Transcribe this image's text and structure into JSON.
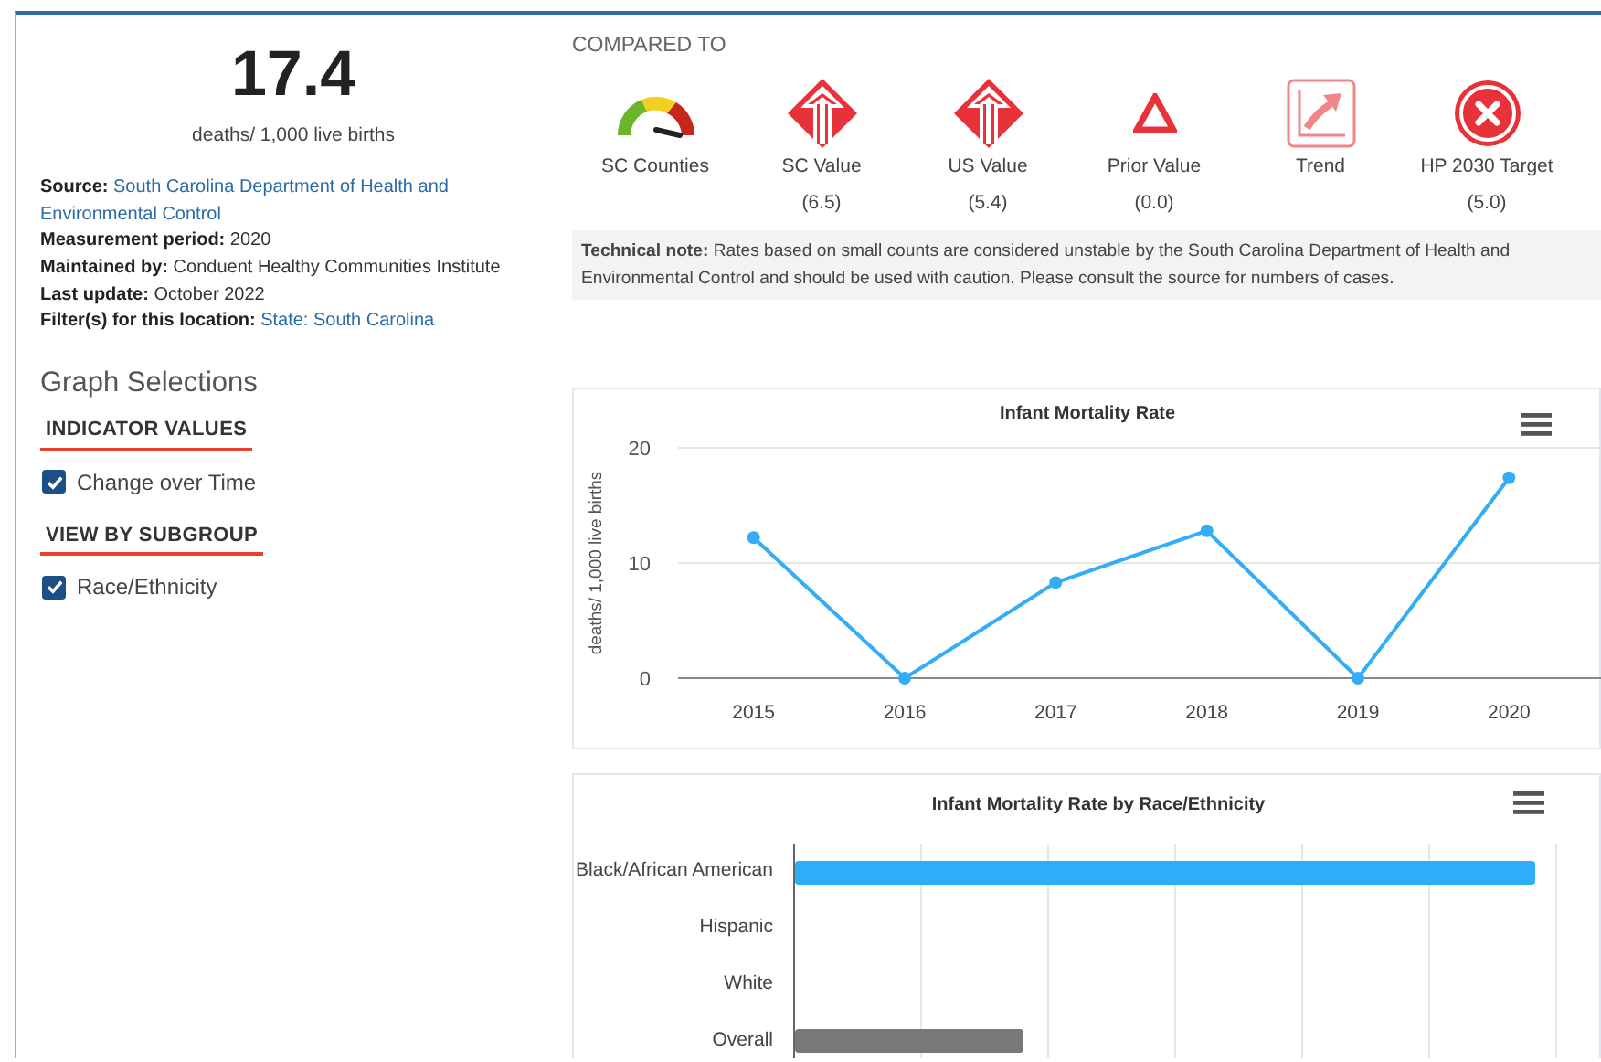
{
  "summary": {
    "value": "17.4",
    "unit": "deaths/ 1,000 live births"
  },
  "meta": [
    {
      "label": "Source:",
      "value": "South Carolina Department of Health and Environmental Control",
      "link": true
    },
    {
      "label": "Measurement period:",
      "value": "2020",
      "link": false
    },
    {
      "label": "Maintained by:",
      "value": "Conduent Healthy Communities Institute",
      "link": false
    },
    {
      "label": "Last update:",
      "value": "October 2022",
      "link": false
    },
    {
      "label": "Filter(s) for this location:",
      "value": "State: South Carolina",
      "link": true
    }
  ],
  "graph_selections": {
    "title": "Graph Selections",
    "groups": [
      {
        "heading": "INDICATOR VALUES",
        "options": [
          {
            "label": "Change over Time",
            "checked": true
          }
        ]
      },
      {
        "heading": "VIEW BY SUBGROUP",
        "options": [
          {
            "label": "Race/Ethnicity",
            "checked": true
          }
        ]
      }
    ]
  },
  "compared_to": {
    "heading": "COMPARED TO",
    "items": [
      {
        "kind": "gauge",
        "label": "SC Counties"
      },
      {
        "kind": "diamond",
        "label": "SC Value",
        "value": "(6.5)"
      },
      {
        "kind": "diamond",
        "label": "US Value",
        "value": "(5.4)"
      },
      {
        "kind": "triangle",
        "label": "Prior Value",
        "value": "(0.0)"
      },
      {
        "kind": "trend",
        "label": "Trend"
      },
      {
        "kind": "cross",
        "label": "HP 2030 Target",
        "value": "(5.0)"
      }
    ]
  },
  "technical_note": "**Technical note:** Rates based on small counts are considered unstable by the South Carolina Department of Health and Environmental Control and should be used with caution. Please consult the source for numbers of cases.",
  "line_chart": {
    "chart_data": {
      "type": "line",
      "title": "Infant Mortality Rate",
      "ylabel": "deaths/ 1,000 live births",
      "categories": [
        "2015",
        "2016",
        "2017",
        "2018",
        "2019",
        "2020"
      ],
      "values": [
        12.2,
        0,
        8.3,
        12.8,
        0,
        17.4
      ],
      "marker": true,
      "ylim": [
        0,
        20
      ],
      "yticks": [
        0,
        10,
        20
      ]
    }
  },
  "bar_chart": {
    "title": "Infant Mortality Rate by Race/Ethnicity",
    "bars": [
      {
        "label": "Black/African American",
        "level": 0.92,
        "color": "#2eaef8"
      },
      {
        "label": "Hispanic"
      },
      {
        "label": "White"
      },
      {
        "label": "Overall",
        "level": 0.285,
        "color": "#787878"
      }
    ]
  }
}
